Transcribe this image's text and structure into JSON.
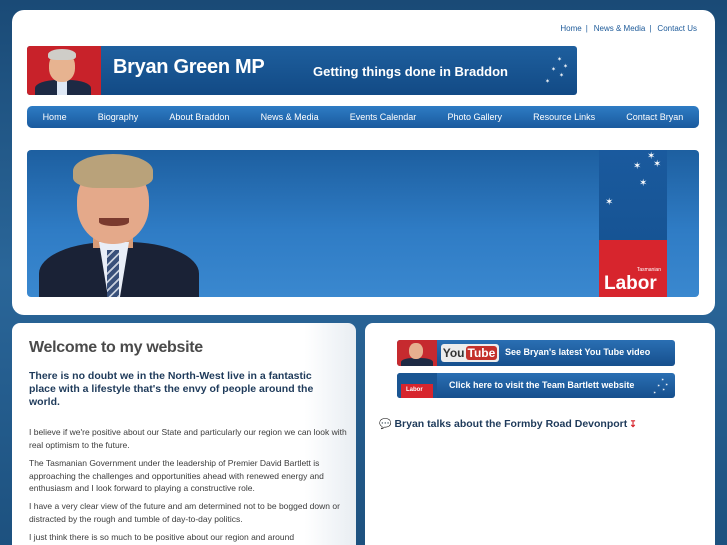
{
  "toplinks": {
    "home": "Home",
    "news": "News & Media",
    "contact": "Contact Us"
  },
  "banner": {
    "title": "Bryan Green MP",
    "tagline": "Getting things done in Braddon"
  },
  "nav": {
    "items": [
      "Home",
      "Biography",
      "About Braddon",
      "News & Media",
      "Events Calendar",
      "Photo Gallery",
      "Resource Links",
      "Contact Bryan"
    ]
  },
  "hero": {
    "labor_small": "Tasmanian",
    "labor_big": "Labor"
  },
  "main": {
    "heading": "Welcome to my website",
    "intro": "There is no doubt we in the North-West live in a fantastic place with a lifestyle that's the envy of people around the world.",
    "paragraphs": [
      "I believe if we're positive about our State and particularly our region we can look with real optimism to the future.",
      "The Tasmanian Government under the leadership of Premier David Bartlett is approaching the challenges and opportunities ahead with renewed energy and enthusiasm and I look forward to playing a constructive role.",
      "I have a very clear view of the future and am determined not to be bogged down or distracted by the rough and tumble of day-to-day politics.",
      "I just think there is so much to be positive about our region and around"
    ]
  },
  "sidebar": {
    "youtube_logo_you": "You",
    "youtube_logo_tube": "Tube",
    "youtube_text": "See Bryan's latest You Tube video",
    "bartlett_logo": "Labor",
    "bartlett_text": "Click here to visit the Team Bartlett website",
    "formby": "Bryan talks about the Formby Road Devonport"
  },
  "colors": {
    "brand_blue": "#1a5a9e",
    "labor_red": "#d7252d",
    "background": "#1e4f7a"
  }
}
